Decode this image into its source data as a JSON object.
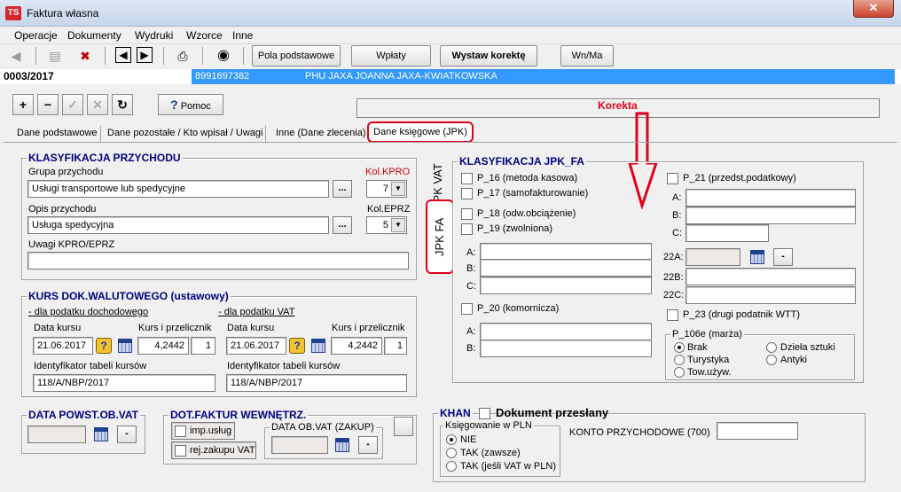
{
  "window": {
    "title": "Faktura własna",
    "app_icon": "TS",
    "close": "✕"
  },
  "menu": [
    "Operacje",
    "Dokumenty",
    "Wydruki",
    "Wzorce",
    "Inne"
  ],
  "toolbar": {
    "pola": "Pola podstawowe",
    "wplaty": "Wpłaty",
    "korekta": "Wystaw korektę",
    "wnma": "Wn/Ma"
  },
  "record": {
    "number": "0003/2017",
    "nip": "8991697382",
    "name": "PHU JAXA JOANNA JAXA-KWIATKOWSKA"
  },
  "nav": {
    "pomoc": "Pomoc",
    "korekta_label": "Korekta"
  },
  "tabs": {
    "t1": "Dane podstawowe",
    "t2": "Dane pozostałe / Kto wpisał / Uwagi",
    "t3": "Inne (Dane zlecenia)",
    "active": "Dane księgowe (JPK)"
  },
  "klasyfikacja": {
    "title": "KLASYFIKACJA PRZYCHODU",
    "grupa_label": "Grupa przychodu",
    "grupa_value": "Usługi transportowe lub spedycyjne",
    "kolkpro_label": "Kol.KPRO",
    "kolkpro_value": "7",
    "opis_label": "Opis przychodu",
    "opis_value": "Usługa spedycyjna",
    "koleprz_label": "Kol.EPRZ",
    "koleprz_value": "5",
    "uwagi_label": "Uwagi KPRO/EPRZ",
    "uwagi_value": "",
    "dots": "..."
  },
  "kurs": {
    "title": "KURS DOK.WALUTOWEGO (ustawowy)",
    "doch_label": "- dla podatku dochodowego",
    "vat_label": "- dla podatku VAT",
    "data_kursu": "Data kursu",
    "kurs_przel": "Kurs i przelicznik",
    "date1": "21.06.2017",
    "rate1": "4,2442",
    "mult1": "1",
    "date2": "21.06.2017",
    "rate2": "4,2442",
    "mult2": "1",
    "ident_label": "Identyfikator tabeli kursów",
    "ident1": "118/A/NBP/2017",
    "ident2": "118/A/NBP/2017"
  },
  "data_powst": {
    "title": "DATA POWST.OB.VAT",
    "value": "",
    "minus": "-"
  },
  "dot_faktur": {
    "title": "DOT.FAKTUR WEWNĘTRZ.",
    "imp": "imp.usług",
    "rej": "rej.zakupu VAT",
    "data_ob_label": "DATA OB.VAT (ZAKUP)",
    "minus": "-"
  },
  "jpk": {
    "title": "KLASYFIKACJA JPK_FA",
    "vtab_vat": "JPK VAT",
    "vtab_fa": "JPK FA",
    "p16": "P_16 (metoda kasowa)",
    "p17": "P_17 (samofakturowanie)",
    "p18": "P_18 (odw.obciążenie)",
    "p19": "P_19 (zwolniona)",
    "p20": "P_20 (komornicza)",
    "p21": "P_21 (przedst.podatkowy)",
    "p23": "P_23 (drugi podatnik WTT)",
    "a": "A:",
    "b": "B:",
    "c": "C:",
    "a22": "22A:",
    "b22": "22B:",
    "c22": "22C:",
    "minus": "-",
    "p106e_title": "P_106e (marża)",
    "brak": "Brak",
    "turystyka": "Turystyka",
    "tow": "Tow.używ.",
    "dziela": "Dzieła sztuki",
    "antyki": "Antyki"
  },
  "khan": {
    "title": "KHAN",
    "dokument": "Dokument przesłany",
    "ksieg_title": "Księgowanie w PLN",
    "nie": "NIE",
    "tak1": "TAK (zawsze)",
    "tak2": "TAK (jeśli VAT w PLN)",
    "konto_label": "KONTO PRZYCHODOWE (700)",
    "konto_value": ""
  },
  "colors": {
    "accent": "#3399ff",
    "highlight": "#e0001a",
    "group_title": "#000080"
  }
}
